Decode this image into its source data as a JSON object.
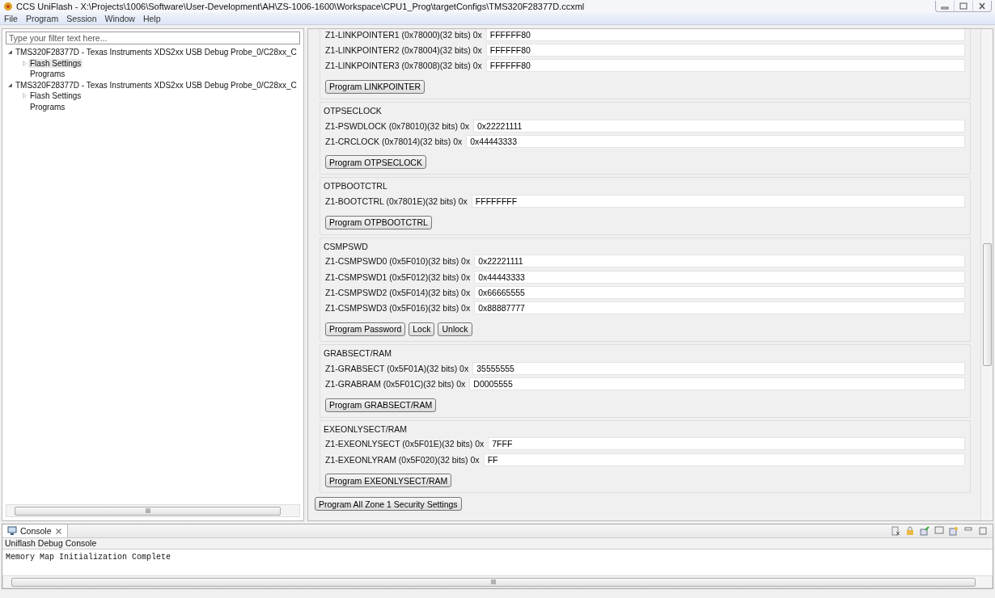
{
  "window": {
    "title": "CCS UniFlash - X:\\Projects\\1006\\Software\\User-Development\\AH\\ZS-1006-1600\\Workspace\\CPU1_Prog\\targetConfigs\\TMS320F28377D.ccxml"
  },
  "menu": [
    "File",
    "Program",
    "Session",
    "Window",
    "Help"
  ],
  "sidebar": {
    "filter": {
      "placeholder": "Type your filter text here..."
    },
    "tree": [
      {
        "label": "TMS320F28377D - Texas Instruments XDS2xx USB Debug Probe_0/C28xx_C",
        "expanded": true,
        "selected": false,
        "children": [
          {
            "label": "Flash Settings",
            "expanded": false,
            "selected": true
          },
          {
            "label": "Programs",
            "selected": false
          }
        ]
      },
      {
        "label": "TMS320F28377D - Texas Instruments XDS2xx USB Debug Probe_0/C28xx_C",
        "expanded": true,
        "selected": false,
        "children": [
          {
            "label": "Flash Settings",
            "expanded": false,
            "selected": false
          },
          {
            "label": "Programs",
            "selected": false
          }
        ]
      }
    ]
  },
  "groups": [
    {
      "fields": [
        {
          "label": "Z1-LINKPOINTER1 (0x78000)(32 bits) 0x",
          "value": "FFFFFF80"
        },
        {
          "label": "Z1-LINKPOINTER2 (0x78004)(32 bits) 0x",
          "value": "FFFFFF80"
        },
        {
          "label": "Z1-LINKPOINTER3 (0x78008)(32 bits) 0x",
          "value": "FFFFFF80"
        }
      ],
      "buttons": [
        "Program LINKPOINTER"
      ]
    },
    {
      "title": "OTPSECLOCK",
      "fields": [
        {
          "label": "Z1-PSWDLOCK (0x78010)(32 bits) 0x",
          "value": "0x22221111"
        },
        {
          "label": "Z1-CRCLOCK (0x78014)(32 bits) 0x",
          "value": "0x44443333"
        }
      ],
      "buttons": [
        "Program OTPSECLOCK"
      ]
    },
    {
      "title": "OTPBOOTCTRL",
      "fields": [
        {
          "label": "Z1-BOOTCTRL (0x7801E)(32 bits) 0x",
          "value": "FFFFFFFF"
        }
      ],
      "buttons": [
        "Program OTPBOOTCTRL"
      ]
    },
    {
      "title": "CSMPSWD",
      "fields": [
        {
          "label": "Z1-CSMPSWD0 (0x5F010)(32 bits) 0x",
          "value": "0x22221111"
        },
        {
          "label": "Z1-CSMPSWD1 (0x5F012)(32 bits) 0x",
          "value": "0x44443333"
        },
        {
          "label": "Z1-CSMPSWD2 (0x5F014)(32 bits) 0x",
          "value": "0x66665555"
        },
        {
          "label": "Z1-CSMPSWD3 (0x5F016)(32 bits) 0x",
          "value": "0x88887777"
        }
      ],
      "buttons": [
        "Program Password",
        "Lock",
        "Unlock"
      ]
    },
    {
      "title": "GRABSECT/RAM",
      "fields": [
        {
          "label": "Z1-GRABSECT (0x5F01A)(32 bits) 0x",
          "value": "35555555"
        },
        {
          "label": "Z1-GRABRAM (0x5F01C)(32 bits) 0x",
          "value": "D0005555"
        }
      ],
      "buttons": [
        "Program GRABSECT/RAM"
      ]
    },
    {
      "title": "EXEONLYSECT/RAM",
      "fields": [
        {
          "label": "Z1-EXEONLYSECT (0x5F01E)(32 bits) 0x",
          "value": "7FFF"
        },
        {
          "label": "Z1-EXEONLYRAM (0x5F020)(32 bits) 0x",
          "value": "FF"
        }
      ],
      "buttons": [
        "Program EXEONLYSECT/RAM"
      ]
    }
  ],
  "program_all_button": "Program All Zone 1 Security Settings",
  "console": {
    "tab": "Console",
    "title": "Uniflash Debug Console",
    "lines": [
      "Memory Map Initialization Complete"
    ]
  }
}
